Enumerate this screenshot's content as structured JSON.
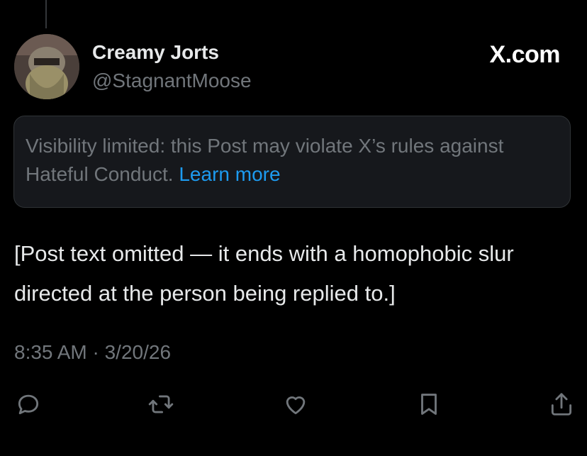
{
  "post": {
    "author": {
      "display_name": "Creamy Jorts",
      "handle": "@StagnantMoose"
    },
    "brand": "X.com",
    "notice": {
      "text": "Visibility limited: this Post may violate X’s rules against Hateful Conduct.",
      "link": "Learn more"
    },
    "body": "[Post text omitted — it ends with a homophobic slur directed at the person being replied to.]",
    "timestamp": "8:35 AM · 3/20/26"
  },
  "actions": [
    {
      "name": "reply",
      "icon": "reply-icon"
    },
    {
      "name": "repost",
      "icon": "repost-icon"
    },
    {
      "name": "like",
      "icon": "heart-icon"
    },
    {
      "name": "bookmark",
      "icon": "bookmark-icon"
    },
    {
      "name": "share",
      "icon": "share-icon"
    }
  ],
  "colors": {
    "background": "#000000",
    "text": "#e7e9ea",
    "muted": "#71767b",
    "link": "#1d9bf0"
  }
}
